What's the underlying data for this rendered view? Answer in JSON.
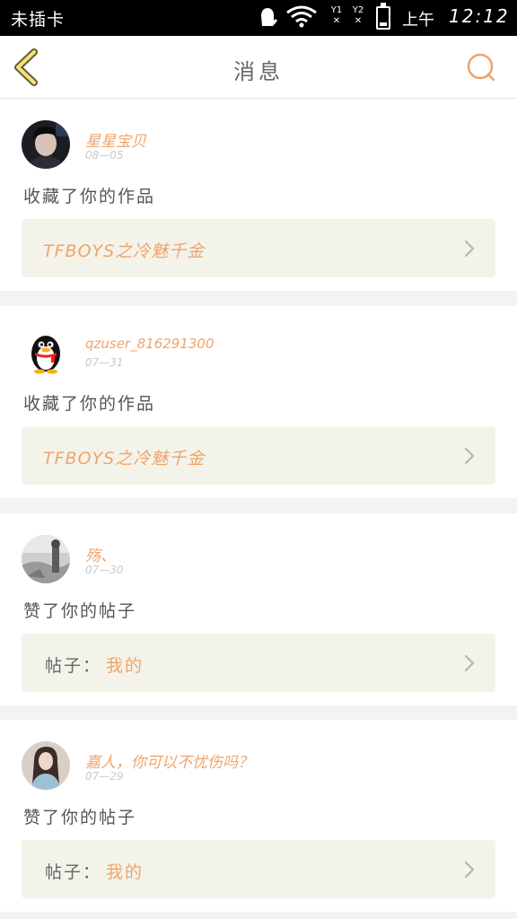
{
  "status_bar": {
    "carrier": "未插卡",
    "sim1": "1",
    "sim2": "2",
    "ampm": "上午",
    "time": "12:12"
  },
  "header": {
    "title": "消息"
  },
  "icons": {
    "back": "chevron-left-icon",
    "search": "search-icon",
    "arrow": "chevron-right-icon"
  },
  "colors": {
    "accent": "#f0a46a",
    "back_yellow": "#f4e27a"
  },
  "messages": [
    {
      "user": "星星宝贝",
      "date": "08—05",
      "action": "收藏了你的作品",
      "target": "TFBOYS之冷魅千金"
    },
    {
      "user": "qzuser_816291300",
      "date": "07—31",
      "action": "收藏了你的作品",
      "target": "TFBOYS之冷魅千金"
    },
    {
      "user": "殇、",
      "date": "07—30",
      "action": "赞了你的帖子",
      "label": "帖子：",
      "target": "我的"
    },
    {
      "user": "嘉人，你可以不忧伤吗？",
      "date": "07—29",
      "action": "赞了你的帖子",
      "label": "帖子：",
      "target": "我的"
    }
  ]
}
